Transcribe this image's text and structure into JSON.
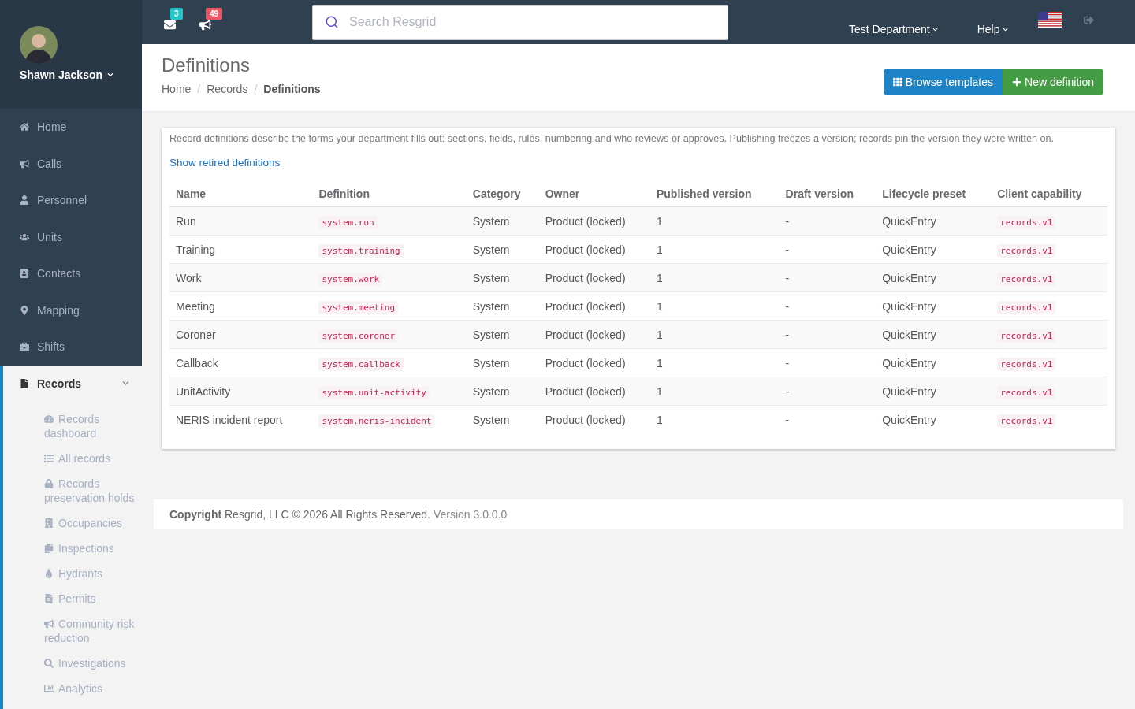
{
  "user": {
    "name": "Shawn Jackson"
  },
  "topbar": {
    "notifications": [
      {
        "kind": "mail",
        "count": "3",
        "color": "#23c6c8"
      },
      {
        "kind": "alerts",
        "count": "49",
        "color": "#ed5565"
      }
    ],
    "search": {
      "placeholder": "Search Resgrid"
    },
    "menus": [
      "Test Department",
      "Help"
    ]
  },
  "sidebar": {
    "items": [
      {
        "kind": "home",
        "label": "Home",
        "expanded": false
      },
      {
        "kind": "calls",
        "label": "Calls",
        "expanded": false
      },
      {
        "kind": "personnel",
        "label": "Personnel",
        "expanded": false
      },
      {
        "kind": "units",
        "label": "Units",
        "expanded": false
      },
      {
        "kind": "contacts",
        "label": "Contacts",
        "expanded": false
      },
      {
        "kind": "mapping",
        "label": "Mapping",
        "expanded": false
      },
      {
        "kind": "shifts",
        "label": "Shifts",
        "expanded": false
      },
      {
        "kind": "records",
        "label": "Records",
        "expanded": true,
        "children": [
          {
            "kind": "dashboard",
            "label": "Records dashboard"
          },
          {
            "kind": "list",
            "label": "All records"
          },
          {
            "kind": "lock",
            "label": "Records preservation holds"
          },
          {
            "kind": "building",
            "label": "Occupancies"
          },
          {
            "kind": "copy",
            "label": "Inspections"
          },
          {
            "kind": "drop",
            "label": "Hydrants"
          },
          {
            "kind": "file",
            "label": "Permits"
          },
          {
            "kind": "calls",
            "label": "Community risk reduction"
          },
          {
            "kind": "search",
            "label": "Investigations"
          },
          {
            "kind": "chart",
            "label": "Analytics"
          }
        ]
      }
    ]
  },
  "page": {
    "title": "Definitions",
    "breadcrumbs": [
      {
        "label": "Home"
      },
      {
        "separator": "/",
        "label": "Records"
      },
      {
        "separator": "/",
        "label": "Definitions"
      }
    ],
    "buttons": [
      {
        "kind": "browse",
        "label": "Browse templates"
      },
      {
        "kind": "new",
        "label": "New definition"
      }
    ]
  },
  "intro": "Record definitions describe the forms your department fills out: sections, fields, rules, numbering and who reviews or approves. Publishing freezes a version; records pin the version they were written on.",
  "link": "Show retired definitions",
  "table": {
    "columns": [
      "Name",
      "Definition",
      "Category",
      "Owner",
      "Published version",
      "Draft version",
      "Lifecycle preset",
      "Client capability"
    ],
    "rows": [
      [
        "Run",
        "system.run",
        "System",
        "Product (locked)",
        "1",
        "-",
        "QuickEntry",
        "records.v1"
      ],
      [
        "Training",
        "system.training",
        "System",
        "Product (locked)",
        "1",
        "-",
        "QuickEntry",
        "records.v1"
      ],
      [
        "Work",
        "system.work",
        "System",
        "Product (locked)",
        "1",
        "-",
        "QuickEntry",
        "records.v1"
      ],
      [
        "Meeting",
        "system.meeting",
        "System",
        "Product (locked)",
        "1",
        "-",
        "QuickEntry",
        "records.v1"
      ],
      [
        "Coroner",
        "system.coroner",
        "System",
        "Product (locked)",
        "1",
        "-",
        "QuickEntry",
        "records.v1"
      ],
      [
        "Callback",
        "system.callback",
        "System",
        "Product (locked)",
        "1",
        "-",
        "QuickEntry",
        "records.v1"
      ],
      [
        "UnitActivity",
        "system.unit-activity",
        "System",
        "Product (locked)",
        "1",
        "-",
        "QuickEntry",
        "records.v1"
      ],
      [
        "NERIS incident report",
        "system.neris-incident",
        "System",
        "Product (locked)",
        "1",
        "-",
        "QuickEntry",
        "records.v1"
      ]
    ]
  },
  "footer": {
    "text": "**Copyright** Resgrid, LLC © 2026 All Rights Reserved.",
    "version": "Version 3.0.0.0"
  }
}
